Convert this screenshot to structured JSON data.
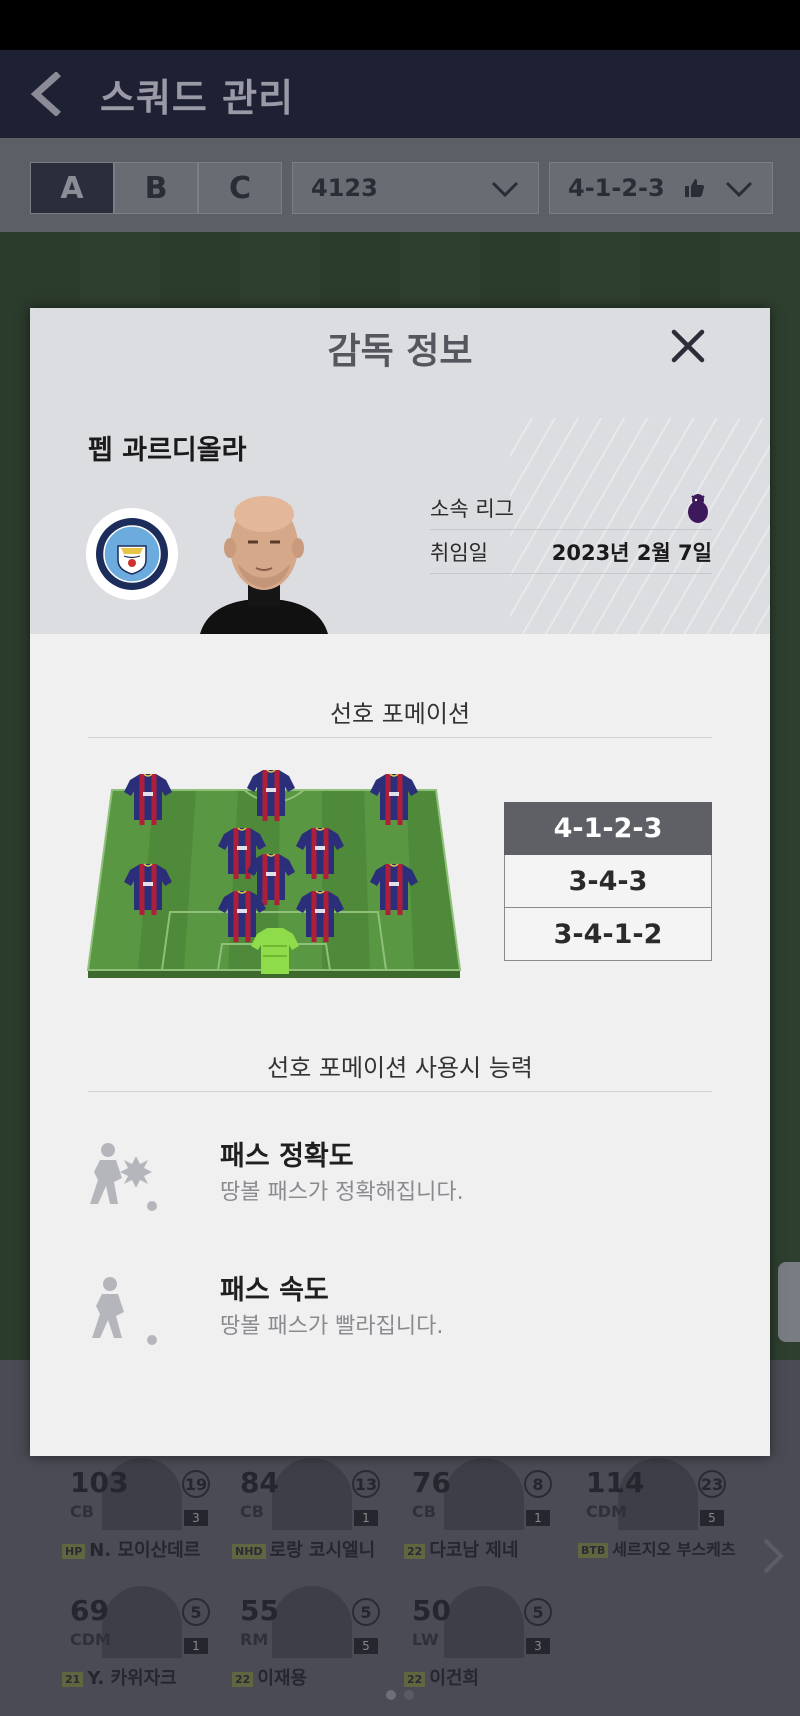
{
  "app": {
    "title": "스쿼드 관리",
    "squad_tabs": [
      "A",
      "B",
      "C"
    ],
    "formation_select": "4123",
    "tactic_select": "4-1-2-3"
  },
  "players_row1": [
    {
      "ovr": "103",
      "pos": "CB",
      "level": "19",
      "grade": "3",
      "season": "HP",
      "name": "N. 모이산데르"
    },
    {
      "ovr": "84",
      "pos": "CB",
      "level": "13",
      "grade": "1",
      "season": "NHD",
      "name": "로랑 코시엘니"
    },
    {
      "ovr": "76",
      "pos": "CB",
      "level": "8",
      "grade": "1",
      "season": "22",
      "name": "다코남 제네"
    },
    {
      "ovr": "114",
      "pos": "CDM",
      "level": "23",
      "grade": "5",
      "season": "BTB",
      "name": "세르지오 부스케츠"
    }
  ],
  "players_row2": [
    {
      "ovr": "69",
      "pos": "CDM",
      "level": "5",
      "grade": "1",
      "season": "21",
      "name": "Y. 카위자크"
    },
    {
      "ovr": "55",
      "pos": "RM",
      "level": "5",
      "grade": "5",
      "season": "22",
      "name": "이재용"
    },
    {
      "ovr": "50",
      "pos": "LW",
      "level": "5",
      "grade": "3",
      "season": "22",
      "name": "이건희"
    }
  ],
  "modal": {
    "title": "감독 정보",
    "coach_name": "펩 과르디올라",
    "club_logo": "manchester-city-crest",
    "league_label": "소속 리그",
    "league_icon": "premier-league-icon",
    "appointed_label": "취임일",
    "appointed_value": "2023년 2월 7일",
    "formation_title": "선호 포메이션",
    "formations": [
      "4-1-2-3",
      "3-4-3",
      "3-4-1-2"
    ],
    "selected_formation": "4-1-2-3",
    "ability_title": "선호 포메이션 사용시 능력",
    "abilities": [
      {
        "name": "패스 정확도",
        "desc": "땅볼 패스가 정확해집니다."
      },
      {
        "name": "패스 속도",
        "desc": "땅볼 패스가 빨라집니다."
      }
    ]
  },
  "colors": {
    "appbar": "#1e2133",
    "modal_bg": "#f0f0f0",
    "selected_formation": "#5f6066",
    "home_kit": "#2b2f7a",
    "keeper_kit": "#8fdc4a"
  }
}
